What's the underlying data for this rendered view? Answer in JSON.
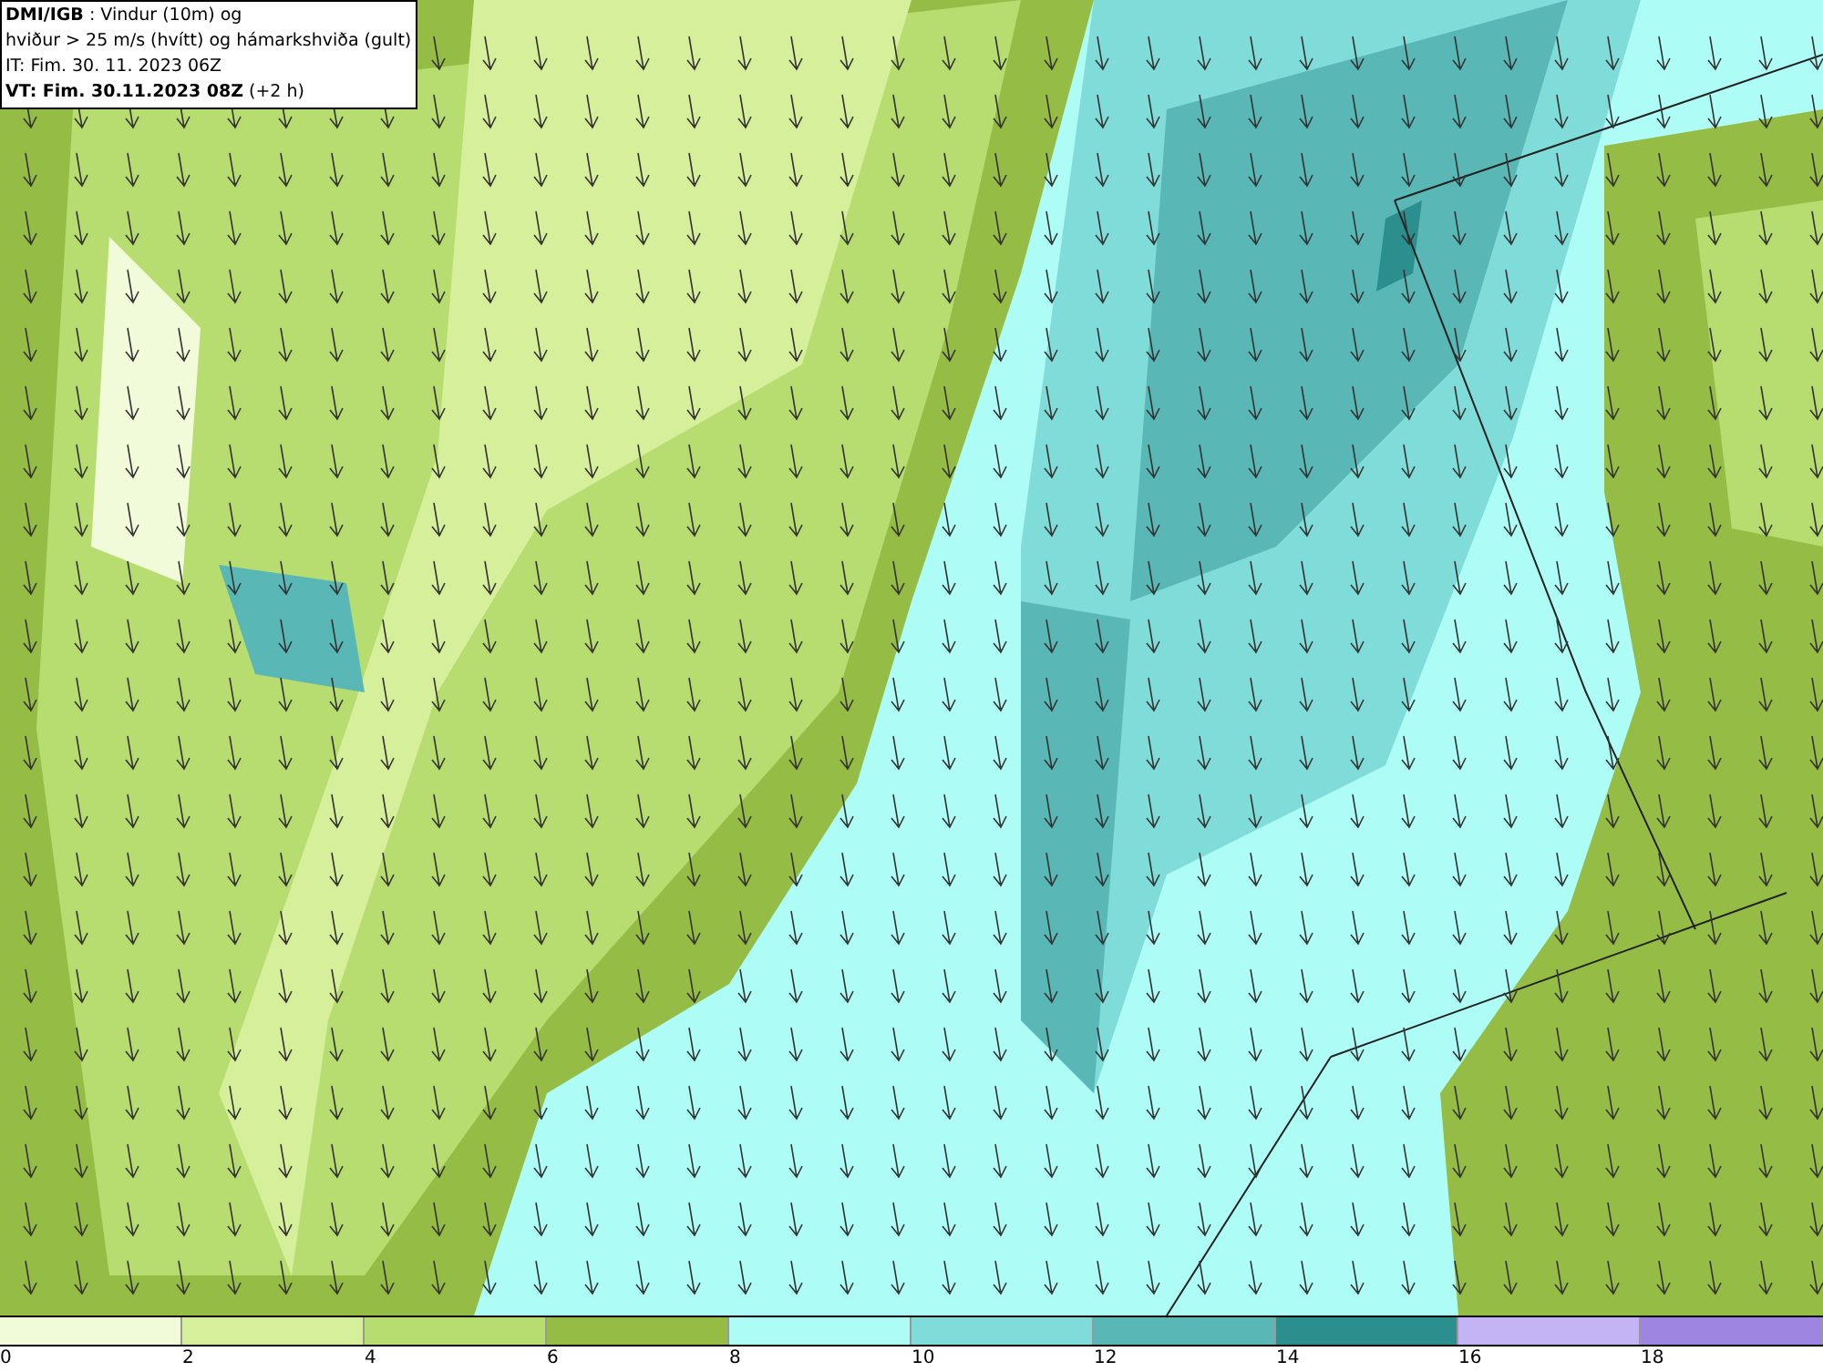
{
  "title_box": {
    "lines": [
      "**DMI/IGB** : Vindur (10m) og",
      "hviður > 25 m/s (hvítt) og hámarkshviða (gult)",
      "IT: Fim. 30. 11. 2023 06Z",
      "**VT: Fim. 30.11.2023 08Z** (+2 h)"
    ]
  },
  "legend": {
    "bins": [
      {
        "color": "#f2fbd9",
        "label": "0"
      },
      {
        "color": "#d6ef9b",
        "label": "2"
      },
      {
        "color": "#b7dc70",
        "label": "4"
      },
      {
        "color": "#95bd45",
        "label": "6"
      },
      {
        "color": "#aefcf6",
        "label": "8"
      },
      {
        "color": "#80dcd8",
        "label": "10"
      },
      {
        "color": "#59b7b6",
        "label": "12"
      },
      {
        "color": "#2b908d",
        "label": "14"
      },
      {
        "color": "#c4b4f5",
        "label": "16"
      },
      {
        "color": "#9c84e0",
        "label": "18"
      }
    ]
  }
}
